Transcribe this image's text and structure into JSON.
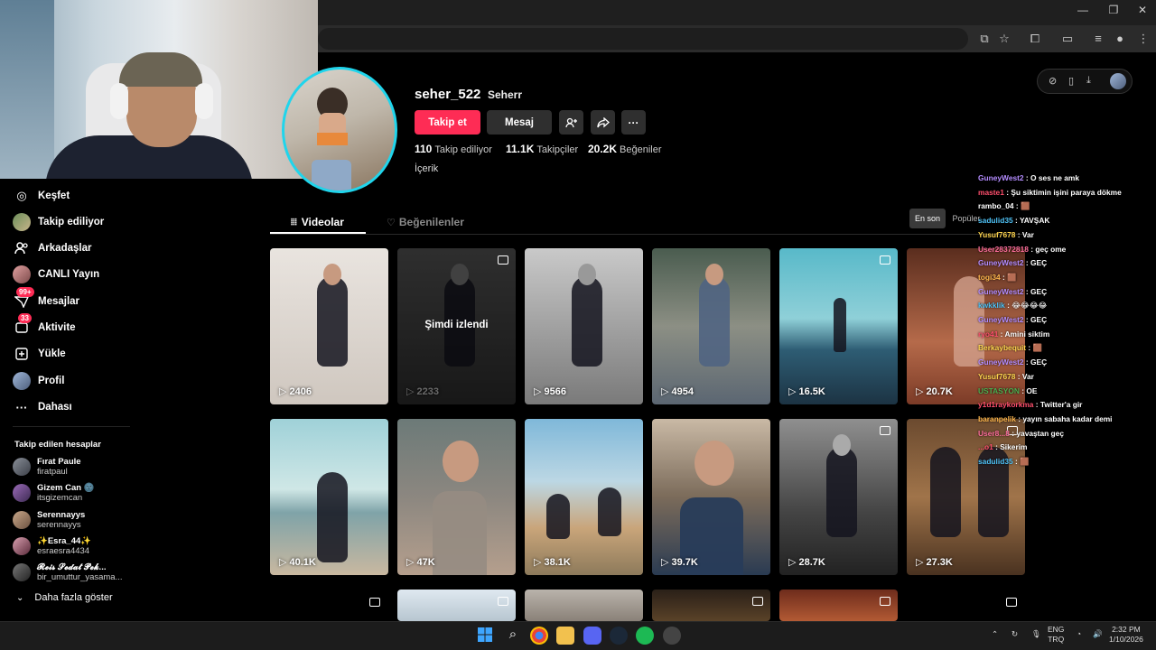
{
  "browser": {
    "window_controls": [
      "—",
      "❐",
      "✕"
    ]
  },
  "sidebar": {
    "items": [
      {
        "label": "Keşfet",
        "icon": "compass-icon",
        "glyph": "◎"
      },
      {
        "label": "Takip ediliyor",
        "icon": "following-avatar-icon",
        "glyph": ""
      },
      {
        "label": "Arkadaşlar",
        "icon": "friends-icon",
        "glyph": "👥"
      },
      {
        "label": "CANLI Yayın",
        "icon": "live-avatar-icon",
        "glyph": ""
      },
      {
        "label": "Mesajlar",
        "icon": "messages-icon",
        "glyph": "✉",
        "badge": "99+"
      },
      {
        "label": "Aktivite",
        "icon": "activity-icon",
        "glyph": "▢",
        "badge": "33"
      },
      {
        "label": "Yükle",
        "icon": "upload-icon",
        "glyph": "⊞"
      },
      {
        "label": "Profil",
        "icon": "profile-avatar-icon",
        "glyph": ""
      },
      {
        "label": "Dahası",
        "icon": "more-icon",
        "glyph": "···"
      }
    ],
    "following_title": "Takip edilen hesaplar",
    "following": [
      {
        "name": "Fırat Paule",
        "handle": "firatpaul"
      },
      {
        "name": "Gizem Can 🌚",
        "handle": "itsgizemcan"
      },
      {
        "name": "Serennayys",
        "handle": "serennayys"
      },
      {
        "name": "✨Esra_44✨",
        "handle": "esraesra4434"
      },
      {
        "name": "𝓡𝓮𝓲𝓼 𝓢𝓮𝓭𝓪𝓽 𝓟𝓮𝓴...",
        "handle": "bir_umuttur_yasama..."
      }
    ],
    "show_more": "Daha fazla göster"
  },
  "profile": {
    "username": "seher_522",
    "nickname": "Seherr",
    "follow_label": "Takip et",
    "message_label": "Mesaj",
    "stats": [
      {
        "value": "110",
        "label": "Takip ediliyor"
      },
      {
        "value": "11.1K",
        "label": "Takipçiler"
      },
      {
        "value": "20.2K",
        "label": "Beğeniler"
      }
    ],
    "bio": "İçerik"
  },
  "tabs": {
    "videos": "Videolar",
    "liked": "Beğenilenler",
    "sort_latest": "En son",
    "sort_popular": "Popüler"
  },
  "videos": [
    {
      "views": "2406",
      "pinned": false
    },
    {
      "views": "2233",
      "pinned": true,
      "watched": "Şimdi izlendi"
    },
    {
      "views": "9566",
      "pinned": false
    },
    {
      "views": "4954",
      "pinned": false
    },
    {
      "views": "16.5K",
      "pinned": true
    },
    {
      "views": "20.7K",
      "pinned": false
    },
    {
      "views": "40.1K",
      "pinned": false
    },
    {
      "views": "47K",
      "pinned": false
    },
    {
      "views": "38.1K",
      "pinned": false
    },
    {
      "views": "39.7K",
      "pinned": false
    },
    {
      "views": "28.7K",
      "pinned": true
    },
    {
      "views": "27.3K",
      "pinned": true
    }
  ],
  "chat": [
    {
      "user": "GuneyWest2",
      "text": "O ses ne amk",
      "color": "#b48cff"
    },
    {
      "user": "maste1",
      "text": "Şu siktimin işini paraya dökme",
      "color": "#ff4f6d"
    },
    {
      "user": "rambo_04",
      "text": "🟫",
      "color": "#ffffff"
    },
    {
      "user": "sadulid35",
      "text": "YAVŞAK",
      "color": "#4fc3f7"
    },
    {
      "user": "Yusuf7678",
      "text": "Var",
      "color": "#ffd54f"
    },
    {
      "user": "User28372818",
      "text": "geç ome",
      "color": "#ff6e9c"
    },
    {
      "user": "GuneyWest2",
      "text": "GEÇ",
      "color": "#b48cff"
    },
    {
      "user": "togi34",
      "text": "🟫",
      "color": "#ffb74d"
    },
    {
      "user": "GuneyWest2",
      "text": "GEÇ",
      "color": "#b48cff"
    },
    {
      "user": "kwkklik",
      "text": "😂😂😂😂",
      "color": "#4fc3f7"
    },
    {
      "user": "GuneyWest2",
      "text": "GEÇ",
      "color": "#b48cff"
    },
    {
      "user": "ryo41",
      "text": "Amini siktim",
      "color": "#ff4f6d"
    },
    {
      "user": "Berkaybequit",
      "text": "🟫",
      "color": "#ffd54f"
    },
    {
      "user": "GuneyWest2",
      "text": "GEÇ",
      "color": "#b48cff"
    },
    {
      "user": "Yusuf7678",
      "text": "Var",
      "color": "#ffd54f"
    },
    {
      "user": "USTASYON",
      "text": "OE",
      "color": "#4caf50"
    },
    {
      "user": "y1d1raykorkma",
      "text": "Twitter'a gir",
      "color": "#ff4f6d"
    },
    {
      "user": "baranpelik",
      "text": "yayın sabaha kadar demi",
      "color": "#ffb74d"
    },
    {
      "user": "User8...8",
      "text": "yavaştan geç",
      "color": "#ff6e9c"
    },
    {
      "user": "...o1",
      "text": "Sikerim",
      "color": "#ff4f6d"
    },
    {
      "user": "sadulid35",
      "text": "🟫",
      "color": "#4fc3f7"
    }
  ],
  "taskbar": {
    "lang": "ENG",
    "region": "TRQ",
    "time": "2:32 PM",
    "date": "1/10/2026"
  },
  "colors": {
    "accent": "#fe2c55",
    "ring": "#20d5ec"
  }
}
